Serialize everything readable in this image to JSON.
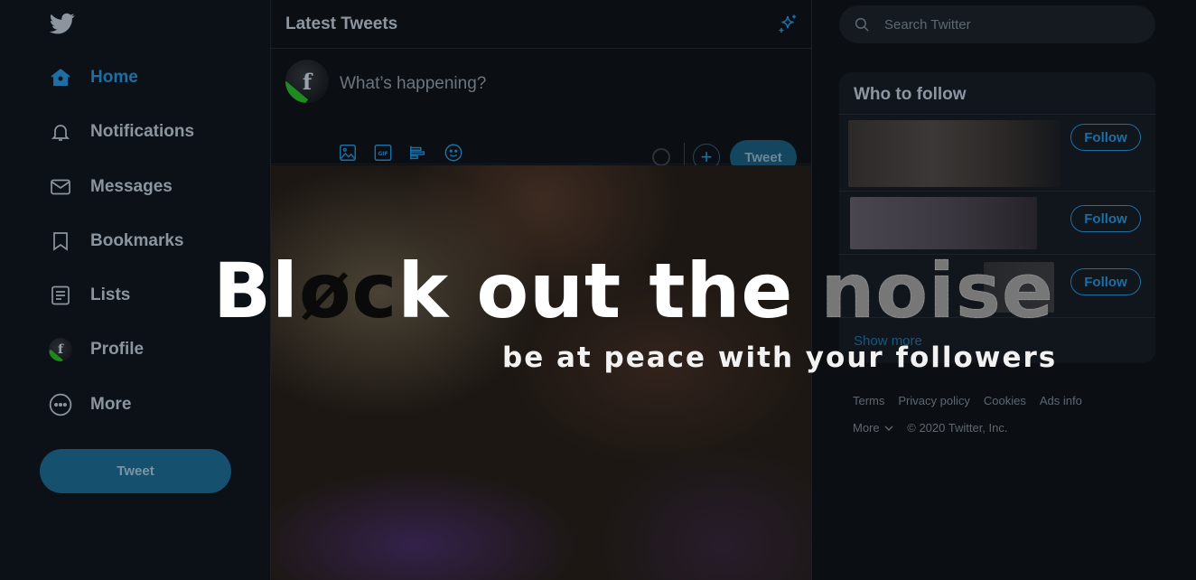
{
  "nav": {
    "items": [
      {
        "label": "Home",
        "icon": "home-icon",
        "active": true
      },
      {
        "label": "Notifications",
        "icon": "bell-icon"
      },
      {
        "label": "Messages",
        "icon": "envelope-icon"
      },
      {
        "label": "Bookmarks",
        "icon": "bookmark-icon"
      },
      {
        "label": "Lists",
        "icon": "list-icon"
      },
      {
        "label": "Profile",
        "icon": "avatar"
      },
      {
        "label": "More",
        "icon": "more-icon"
      }
    ],
    "tweet_label": "Tweet"
  },
  "center": {
    "title": "Latest Tweets",
    "composer": {
      "avatar_letter": "f",
      "placeholder": "What’s happening?",
      "tweet_label": "Tweet"
    }
  },
  "right": {
    "search_placeholder": "Search Twitter",
    "who_to_follow": {
      "title": "Who to follow",
      "follow_label": "Follow",
      "show_more": "Show more"
    },
    "footer": {
      "links": [
        "Terms",
        "Privacy policy",
        "Cookies",
        "Ads info"
      ],
      "more": "More",
      "copyright": "© 2020 Twitter, Inc."
    }
  },
  "overlay": {
    "headline_parts": [
      "Bl",
      "ø",
      "c",
      "k",
      " out the ",
      "noise"
    ],
    "tagline": "be at peace with your followers"
  },
  "colors": {
    "accent": "#1c6ea4",
    "background": "#0c1016",
    "nav_text": "#8c959e"
  }
}
